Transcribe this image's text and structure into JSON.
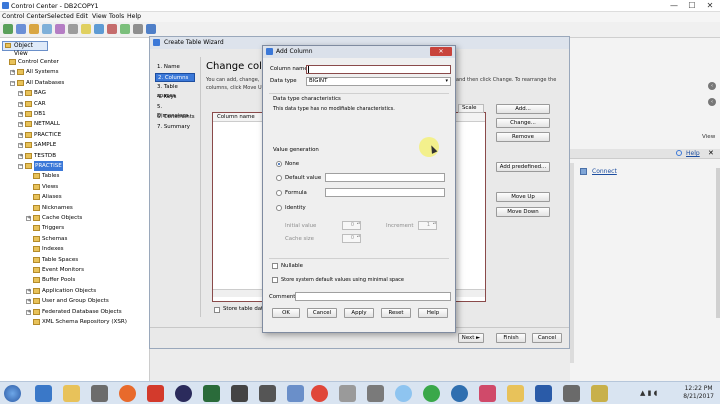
{
  "window": {
    "title": "Control Center - DB2COPY1",
    "min": "—",
    "max": "☐",
    "close": "✕"
  },
  "menu": [
    "Control Center",
    "Selected",
    "Edit",
    "View",
    "Tools",
    "Help"
  ],
  "left_pane": {
    "object_view_button": "Object View",
    "tree": [
      {
        "label": "Control Center",
        "level": 0,
        "expander": ""
      },
      {
        "label": "All Systems",
        "level": 1,
        "expander": "+"
      },
      {
        "label": "All Databases",
        "level": 1,
        "expander": "−"
      },
      {
        "label": "BAG",
        "level": 2,
        "expander": "+"
      },
      {
        "label": "CAR",
        "level": 2,
        "expander": "+"
      },
      {
        "label": "DB1",
        "level": 2,
        "expander": "+"
      },
      {
        "label": "NETMALL",
        "level": 2,
        "expander": "+"
      },
      {
        "label": "PRACTICE",
        "level": 2,
        "expander": "+"
      },
      {
        "label": "SAMPLE",
        "level": 2,
        "expander": "+"
      },
      {
        "label": "TESTDB",
        "level": 2,
        "expander": "+"
      },
      {
        "label": "PRACTISE",
        "level": 2,
        "expander": "−",
        "selected": true
      },
      {
        "label": "Tables",
        "level": 3,
        "expander": ""
      },
      {
        "label": "Views",
        "level": 3,
        "expander": ""
      },
      {
        "label": "Aliases",
        "level": 3,
        "expander": ""
      },
      {
        "label": "Nicknames",
        "level": 3,
        "expander": ""
      },
      {
        "label": "Cache Objects",
        "level": 3,
        "expander": "+"
      },
      {
        "label": "Triggers",
        "level": 3,
        "expander": ""
      },
      {
        "label": "Schemas",
        "level": 3,
        "expander": ""
      },
      {
        "label": "Indexes",
        "level": 3,
        "expander": ""
      },
      {
        "label": "Table Spaces",
        "level": 3,
        "expander": ""
      },
      {
        "label": "Event Monitors",
        "level": 3,
        "expander": ""
      },
      {
        "label": "Buffer Pools",
        "level": 3,
        "expander": ""
      },
      {
        "label": "Application Objects",
        "level": 3,
        "expander": "+"
      },
      {
        "label": "User and Group Objects",
        "level": 3,
        "expander": "+"
      },
      {
        "label": "Federated Database Objects",
        "level": 3,
        "expander": "+"
      },
      {
        "label": "XML Schema Repository (XSR)",
        "level": 3,
        "expander": ""
      }
    ]
  },
  "right_pane": {
    "view": "View",
    "help": "Help",
    "connect": "Connect"
  },
  "wizard": {
    "title": "Create Table Wizard",
    "steps": [
      "1. Name",
      "2. Columns",
      "3. Table spaces",
      "4. Keys",
      "5. Dimensions",
      "6. Constraints",
      "7. Summary"
    ],
    "active_step": 1,
    "heading": "Change colum",
    "desc_line1": "You can add, change,",
    "desc_line2": "columns, click Move U",
    "desc_right": "and then click Change. To rearrange the",
    "col_header_name": "Column name",
    "col_header_scale": "Scale",
    "buttons": {
      "add": "Add...",
      "change": "Change...",
      "remove": "Remove",
      "add_predefined": "Add predefined...",
      "move_up": "Move Up",
      "move_down": "Move Down",
      "next": "Next ►",
      "finish": "Finish",
      "cancel": "Cancel"
    },
    "store_table_data": "Store table data"
  },
  "dialog": {
    "title": "Add Column",
    "column_name_label": "Column name",
    "column_name_value": "",
    "data_type_label": "Data type",
    "data_type_value": "BIGINT",
    "dtc_heading": "Data type characteristics",
    "dtc_text": "This data type has no modifiable characteristics.",
    "value_generation_heading": "Value generation",
    "options": {
      "none": "None",
      "default_value": "Default value",
      "formula": "Formula",
      "identity": "Identity"
    },
    "initial_value_label": "Initial value",
    "initial_value": "0",
    "increment_label": "Increment",
    "increment_value": "1",
    "cache_size_label": "Cache size",
    "cache_size_value": "0",
    "nullable": "Nullable",
    "store_defaults": "Store system default values using minimal space",
    "comment_label": "Comment",
    "buttons": {
      "ok": "OK",
      "cancel": "Cancel",
      "apply": "Apply",
      "reset": "Reset",
      "help": "Help"
    }
  },
  "taskbar": {
    "time": "12:22 PM",
    "date": "8/21/2017"
  },
  "colors": {
    "accent": "#3b78d8",
    "cursor_highlight": "#f3f07a"
  }
}
